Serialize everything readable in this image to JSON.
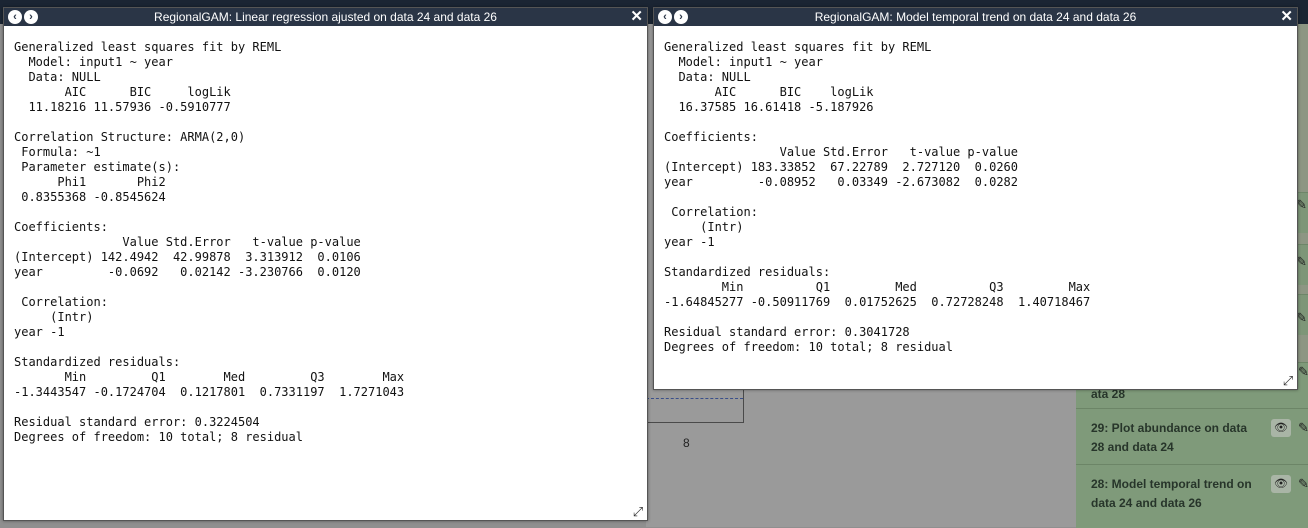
{
  "background": {
    "plot_tick": "8",
    "history_items": [
      {
        "label": "ata 28"
      },
      {
        "label": "29: Plot abundance on data 28 and data 24"
      },
      {
        "label": "28: Model temporal trend on data 24 and data 26"
      }
    ],
    "icons": {
      "eye": "eye-icon",
      "edit": "pencil-icon"
    }
  },
  "window_left": {
    "title": "RegionalGAM: Linear regression ajusted on data 24 and data 26",
    "output": "Generalized least squares fit by REML\n  Model: input1 ~ year\n  Data: NULL\n       AIC      BIC     logLik\n  11.18216 11.57936 -0.5910777\n\nCorrelation Structure: ARMA(2,0)\n Formula: ~1\n Parameter estimate(s):\n      Phi1       Phi2\n 0.8355368 -0.8545624\n\nCoefficients:\n               Value Std.Error   t-value p-value\n(Intercept) 142.4942  42.99878  3.313912  0.0106\nyear         -0.0692   0.02142 -3.230766  0.0120\n\n Correlation:\n     (Intr)\nyear -1\n\nStandardized residuals:\n       Min         Q1        Med         Q3        Max\n-1.3443547 -0.1724704  0.1217801  0.7331197  1.7271043\n\nResidual standard error: 0.3224504\nDegrees of freedom: 10 total; 8 residual",
    "icons": {
      "back": "chevron-left-icon",
      "forward": "chevron-right-icon",
      "close": "close-icon",
      "resize": "resize-icon"
    }
  },
  "window_right": {
    "title": "RegionalGAM: Model temporal trend on data 24 and data 26",
    "output": "Generalized least squares fit by REML\n  Model: input1 ~ year\n  Data: NULL\n       AIC      BIC    logLik\n  16.37585 16.61418 -5.187926\n\nCoefficients:\n                Value Std.Error   t-value p-value\n(Intercept) 183.33852  67.22789  2.727120  0.0260\nyear         -0.08952   0.03349 -2.673082  0.0282\n\n Correlation:\n     (Intr)\nyear -1\n\nStandardized residuals:\n        Min          Q1         Med          Q3         Max\n-1.64845277 -0.50911769  0.01752625  0.72728248  1.40718467\n\nResidual standard error: 0.3041728\nDegrees of freedom: 10 total; 8 residual",
    "icons": {
      "back": "chevron-left-icon",
      "forward": "chevron-right-icon",
      "close": "close-icon",
      "resize": "resize-icon"
    }
  }
}
